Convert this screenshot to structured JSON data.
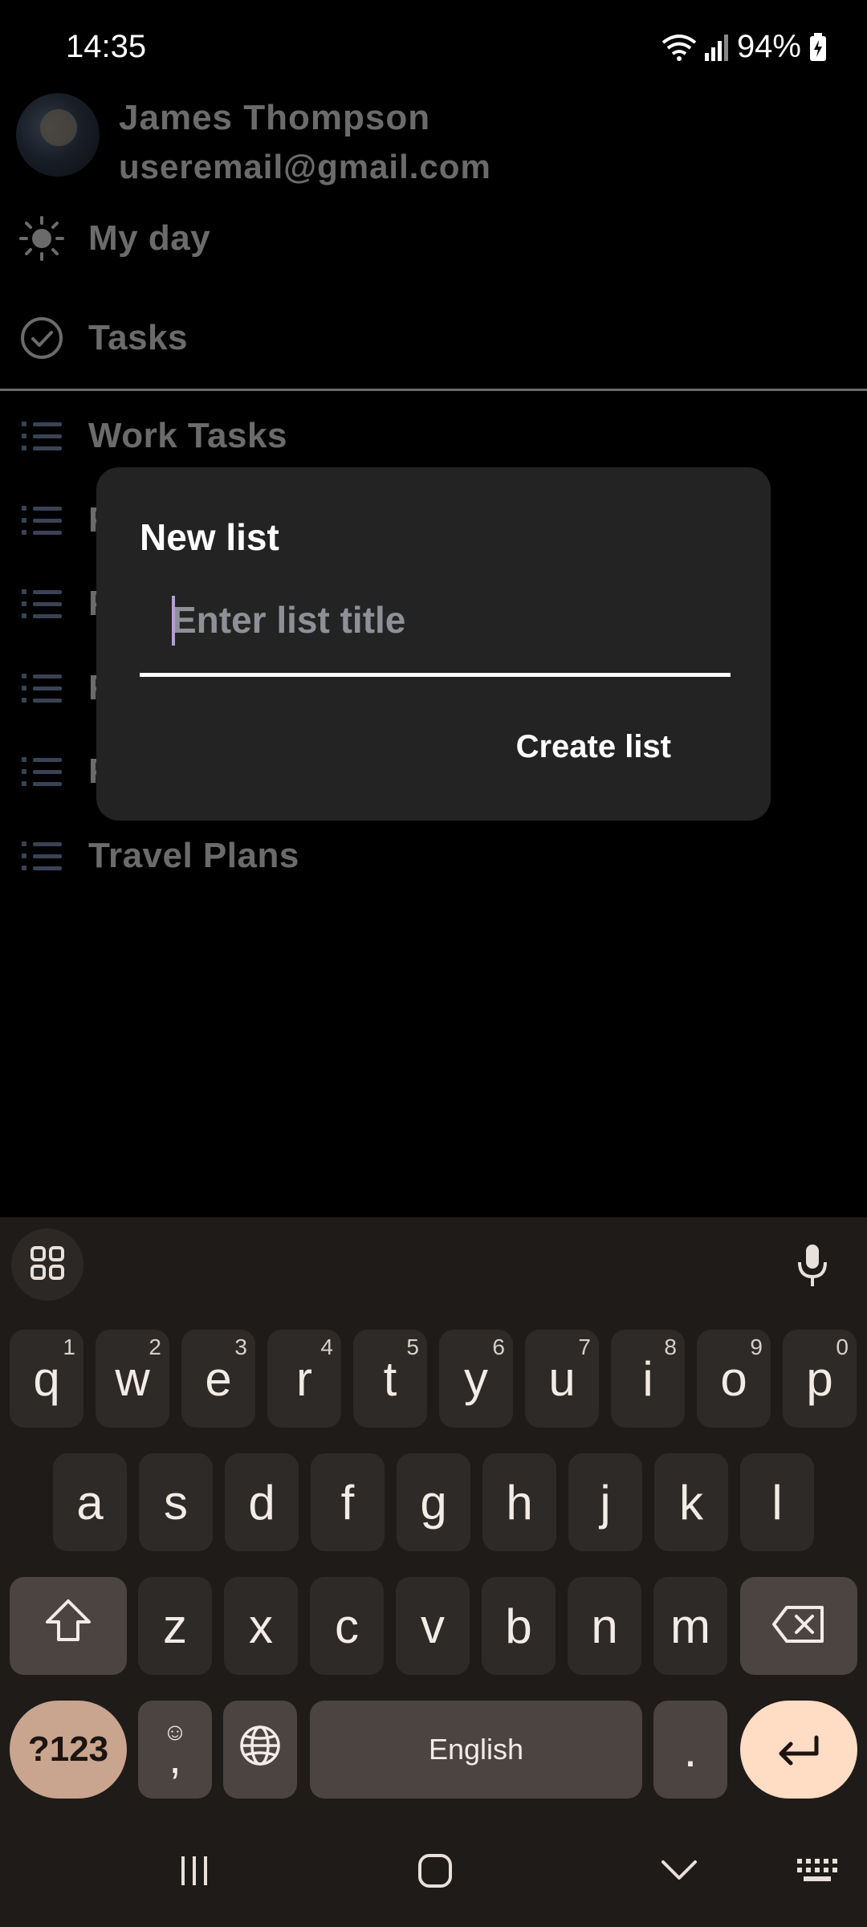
{
  "status_bar": {
    "time": "14:35",
    "battery": "94%"
  },
  "drawer": {
    "profile": {
      "name": "James Thompson",
      "email": "useremail@gmail.com"
    },
    "items": [
      {
        "label": "My day",
        "icon": "sun-icon"
      },
      {
        "label": "Tasks",
        "icon": "check-circle-icon"
      }
    ],
    "lists": [
      {
        "label": "Work Tasks"
      },
      {
        "label": "P"
      },
      {
        "label": "P"
      },
      {
        "label": "P"
      },
      {
        "label": "P"
      },
      {
        "label": "Travel Plans"
      }
    ]
  },
  "dialog": {
    "title": "New list",
    "input_placeholder": "Enter list title",
    "input_value": "",
    "create_label": "Create list",
    "accent_color": "#b39ddb"
  },
  "keyboard": {
    "row1": [
      {
        "k": "q",
        "s": "1"
      },
      {
        "k": "w",
        "s": "2"
      },
      {
        "k": "e",
        "s": "3"
      },
      {
        "k": "r",
        "s": "4"
      },
      {
        "k": "t",
        "s": "5"
      },
      {
        "k": "y",
        "s": "6"
      },
      {
        "k": "u",
        "s": "7"
      },
      {
        "k": "i",
        "s": "8"
      },
      {
        "k": "o",
        "s": "9"
      },
      {
        "k": "p",
        "s": "0"
      }
    ],
    "row2": [
      "a",
      "s",
      "d",
      "f",
      "g",
      "h",
      "j",
      "k",
      "l"
    ],
    "row3": [
      "z",
      "x",
      "c",
      "v",
      "b",
      "n",
      "m"
    ],
    "symbols_label": "?123",
    "comma_label": ",",
    "space_label": "English",
    "period_label": "."
  }
}
